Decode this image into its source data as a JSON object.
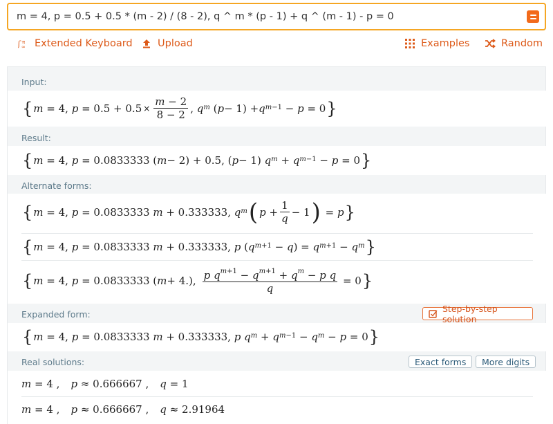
{
  "query": {
    "text": "m = 4, p = 0.5 + 0.5 * (m - 2) / (8 - 2), q ^ m * (p - 1) + q ^ (m - 1) - p = 0"
  },
  "toolbar": {
    "extended_keyboard": "Extended Keyboard",
    "upload": "Upload",
    "examples": "Examples",
    "random": "Random"
  },
  "pods": {
    "input": {
      "title": "Input:"
    },
    "result": {
      "title": "Result:"
    },
    "alternate": {
      "title": "Alternate forms:"
    },
    "expanded": {
      "title": "Expanded form:",
      "step_button": "Step-by-step solution"
    },
    "real": {
      "title": "Real solutions:",
      "exact_button": "Exact forms",
      "more_button": "More digits",
      "solutions": [
        {
          "m": "4",
          "p": "0.666667",
          "q_rel": "=",
          "q": "1"
        },
        {
          "m": "4",
          "p": "0.666667",
          "q_rel": "≈",
          "q": "2.91964"
        }
      ]
    }
  },
  "colors": {
    "accent": "#f26a1b",
    "link": "#dd5a19",
    "pod_title": "#5d7a8a",
    "panel_bg": "#f3f5f6"
  }
}
